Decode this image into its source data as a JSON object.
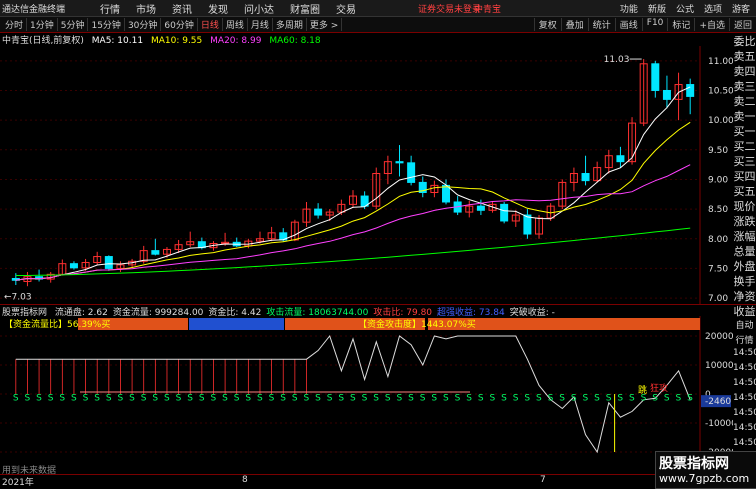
{
  "titlebar": {
    "app": "通达信金融终端",
    "menu": [
      "行情",
      "市场",
      "资讯",
      "发现",
      "问小达",
      "财富圈",
      "交易"
    ],
    "warning": "证券交易未登录",
    "stock": "中青宝",
    "right": [
      "功能",
      "新版",
      "公式",
      "选项",
      "游客"
    ]
  },
  "tabs": {
    "items": [
      "分时",
      "1分钟",
      "5分钟",
      "15分钟",
      "30分钟",
      "60分钟",
      "日线",
      "周线",
      "月线",
      "多周期",
      "更多 >"
    ],
    "active_index": 6,
    "tools": [
      "复权",
      "叠加",
      "统计",
      "画线",
      "F10",
      "标记",
      "+自选",
      "返回"
    ]
  },
  "info": {
    "name": "中青宝(日线,前复权)",
    "ma5": "MA5: 10.11",
    "ma10": "MA10: 9.55",
    "ma20": "MA20: 8.99",
    "ma60": "MA60: 8.18"
  },
  "indicator": {
    "name": "股票指标网",
    "items": [
      {
        "text": "流通盘: 2.62",
        "color": "#dddddd"
      },
      {
        "text": "资金流量: 999284.00",
        "color": "#dddddd"
      },
      {
        "text": "资金比: 4.42",
        "color": "#dddddd"
      },
      {
        "text": "攻击流量: 18063744.00",
        "color": "#00ff66"
      },
      {
        "text": "攻击比: 79.80",
        "color": "#ff4040"
      },
      {
        "text": "超强收益: 73.84",
        "color": "#4060ff"
      },
      {
        "text": "突破收益: -",
        "color": "#dddddd"
      }
    ],
    "label_a": "【资金流量比】56.39%买",
    "label_b": "【资金攻击度】1443.07%买",
    "jump": "跳",
    "attack": "狂攻"
  },
  "price_axis": [
    "11.00",
    "10.50",
    "10.00",
    "9.50",
    "9.00",
    "8.50",
    "8.00",
    "7.50",
    "7.00"
  ],
  "ind_axis": [
    "20000",
    "10000",
    "0",
    "-2460",
    "-10000",
    "-20000"
  ],
  "price_marks": {
    "high": "11.03",
    "low": "7.03"
  },
  "right_col": [
    "委比",
    "卖五",
    "卖四",
    "卖三",
    "卖二",
    "卖一",
    "买一",
    "买二",
    "买三",
    "买四",
    "买五",
    "现价",
    "涨跌",
    "涨幅",
    "总量",
    "外盘",
    "换手",
    "净资",
    "收益",
    "自动",
    "行情",
    "14:50",
    "14:50",
    "14:50",
    "14:50",
    "14:50",
    "14:50",
    "14:50",
    "14:50",
    "14:50"
  ],
  "footer": {
    "year": "2021年",
    "m8": "8",
    "m7": "7"
  },
  "watermark": {
    "a": "股票指标网",
    "b": "www.7gpzb.com"
  },
  "future_note": "用到未来数据",
  "colors": {
    "up": "#ff3030",
    "down": "#00e5ff",
    "ma5": "#ffffff",
    "ma10": "#ffff00",
    "ma20": "#ff40ff",
    "ma60": "#00ff00"
  },
  "chart_data": {
    "type": "candlestick",
    "ylim": [
      6.9,
      11.25
    ],
    "ohlc": [
      [
        7.33,
        7.42,
        7.22,
        7.3
      ],
      [
        7.28,
        7.44,
        7.2,
        7.36
      ],
      [
        7.36,
        7.48,
        7.28,
        7.32
      ],
      [
        7.32,
        7.44,
        7.26,
        7.4
      ],
      [
        7.4,
        7.65,
        7.38,
        7.58
      ],
      [
        7.58,
        7.62,
        7.48,
        7.51
      ],
      [
        7.51,
        7.66,
        7.46,
        7.6
      ],
      [
        7.6,
        7.78,
        7.55,
        7.7
      ],
      [
        7.7,
        7.72,
        7.46,
        7.5
      ],
      [
        7.5,
        7.62,
        7.44,
        7.56
      ],
      [
        7.56,
        7.66,
        7.52,
        7.62
      ],
      [
        7.62,
        7.88,
        7.58,
        7.8
      ],
      [
        7.8,
        8.0,
        7.72,
        7.74
      ],
      [
        7.74,
        7.86,
        7.68,
        7.82
      ],
      [
        7.82,
        7.98,
        7.76,
        7.9
      ],
      [
        7.9,
        8.12,
        7.86,
        7.95
      ],
      [
        7.95,
        8.02,
        7.82,
        7.85
      ],
      [
        7.85,
        7.96,
        7.8,
        7.92
      ],
      [
        7.92,
        8.1,
        7.88,
        7.94
      ],
      [
        7.94,
        8.02,
        7.86,
        7.88
      ],
      [
        7.88,
        8.0,
        7.84,
        7.96
      ],
      [
        7.96,
        8.12,
        7.92,
        8.0
      ],
      [
        8.0,
        8.2,
        7.96,
        8.1
      ],
      [
        8.1,
        8.18,
        7.95,
        7.98
      ],
      [
        7.98,
        8.32,
        7.96,
        8.28
      ],
      [
        8.28,
        8.62,
        8.2,
        8.5
      ],
      [
        8.5,
        8.6,
        8.34,
        8.4
      ],
      [
        8.4,
        8.5,
        8.3,
        8.45
      ],
      [
        8.45,
        8.66,
        8.4,
        8.58
      ],
      [
        8.58,
        8.82,
        8.52,
        8.72
      ],
      [
        8.72,
        8.8,
        8.5,
        8.55
      ],
      [
        8.55,
        9.2,
        8.5,
        9.1
      ],
      [
        9.1,
        9.4,
        8.92,
        9.3
      ],
      [
        9.3,
        9.58,
        9.05,
        9.28
      ],
      [
        9.28,
        9.4,
        8.9,
        8.95
      ],
      [
        8.95,
        9.05,
        8.7,
        8.78
      ],
      [
        8.78,
        8.98,
        8.7,
        8.9
      ],
      [
        8.9,
        9.0,
        8.58,
        8.62
      ],
      [
        8.62,
        8.72,
        8.4,
        8.45
      ],
      [
        8.45,
        8.64,
        8.36,
        8.55
      ],
      [
        8.55,
        8.66,
        8.4,
        8.48
      ],
      [
        8.48,
        8.62,
        8.44,
        8.58
      ],
      [
        8.58,
        8.62,
        8.26,
        8.3
      ],
      [
        8.3,
        8.48,
        8.2,
        8.4
      ],
      [
        8.4,
        8.5,
        8.0,
        8.08
      ],
      [
        8.08,
        8.4,
        8.0,
        8.35
      ],
      [
        8.35,
        8.6,
        8.3,
        8.55
      ],
      [
        8.55,
        9.0,
        8.5,
        8.95
      ],
      [
        8.95,
        9.2,
        8.8,
        9.1
      ],
      [
        9.1,
        9.4,
        8.9,
        8.98
      ],
      [
        8.98,
        9.3,
        8.95,
        9.2
      ],
      [
        9.2,
        9.5,
        9.1,
        9.4
      ],
      [
        9.4,
        9.55,
        9.2,
        9.3
      ],
      [
        9.3,
        10.05,
        9.25,
        9.95
      ],
      [
        9.95,
        11.03,
        9.9,
        10.95
      ],
      [
        10.95,
        11.0,
        10.38,
        10.5
      ],
      [
        10.5,
        10.75,
        10.2,
        10.35
      ],
      [
        10.35,
        10.8,
        10.0,
        10.6
      ],
      [
        10.6,
        10.7,
        10.1,
        10.4
      ]
    ]
  }
}
